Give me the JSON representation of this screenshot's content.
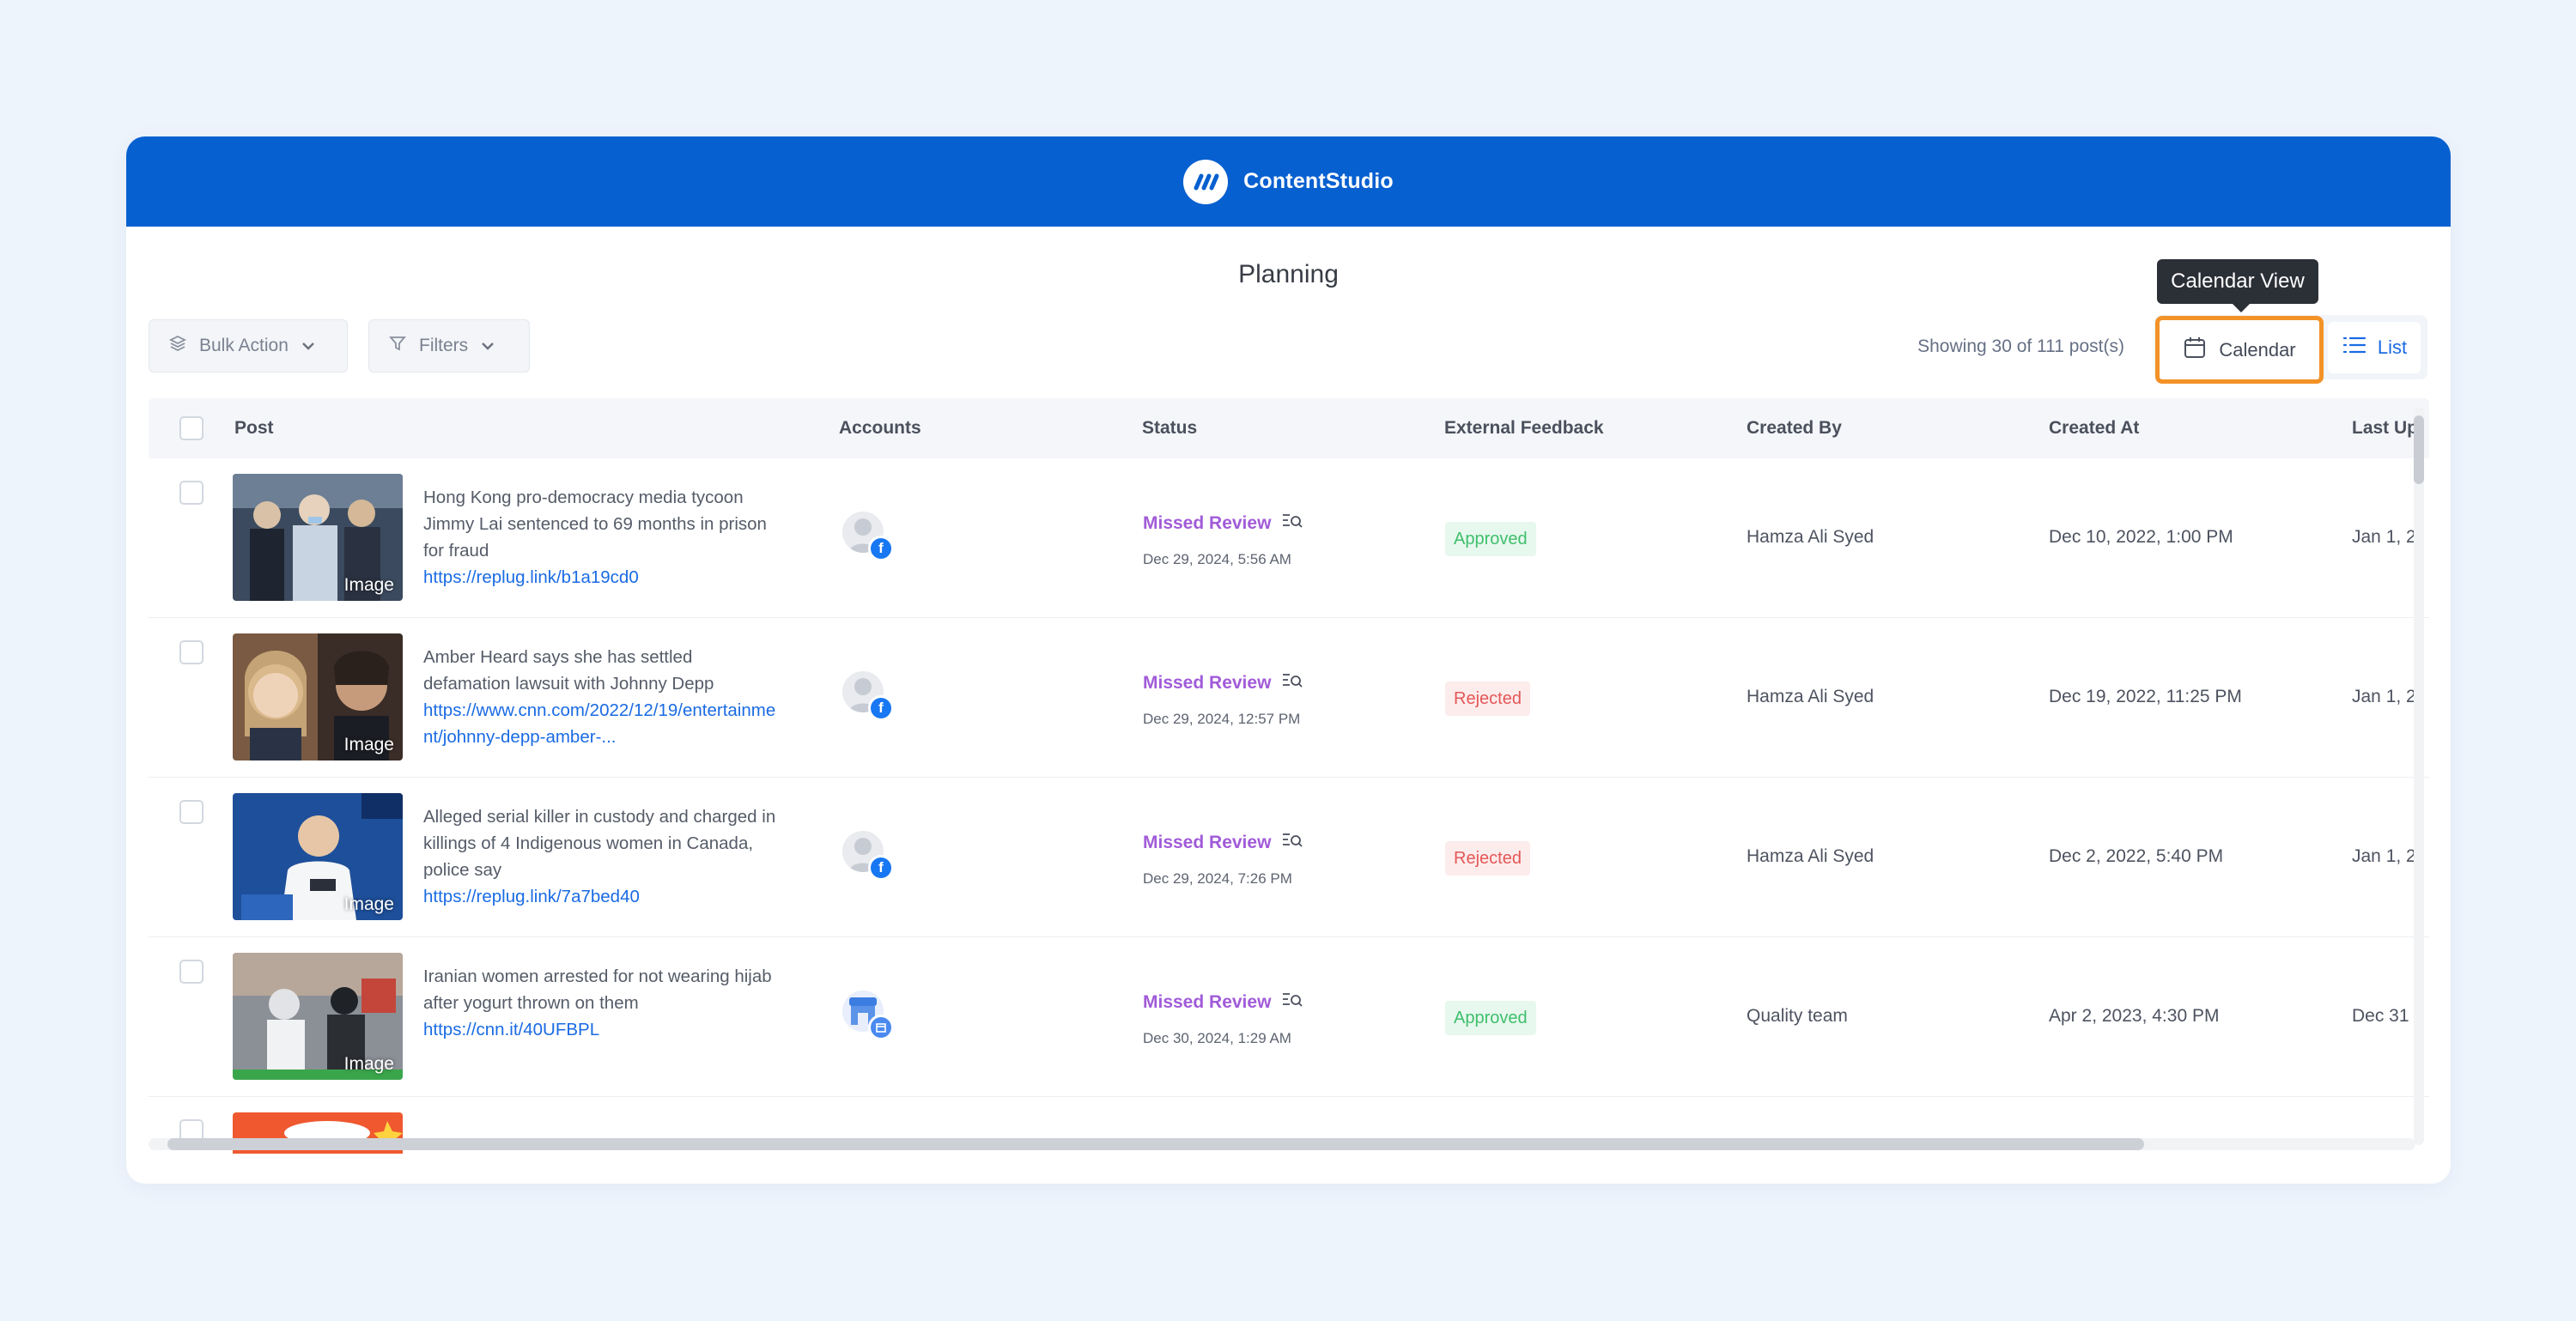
{
  "app": {
    "brand": "ContentStudio"
  },
  "page": {
    "title": "Planning"
  },
  "toolbar": {
    "bulk_action_label": "Bulk Action",
    "filters_label": "Filters",
    "showing_text": "Showing 30 of 111 post(s)",
    "calendar_label": "Calendar",
    "list_label": "List",
    "tooltip": "Calendar View"
  },
  "table": {
    "columns": {
      "post": "Post",
      "accounts": "Accounts",
      "status": "Status",
      "feedback": "External Feedback",
      "created_by": "Created By",
      "created_at": "Created At",
      "last_updated": "Last Up"
    },
    "rows": [
      {
        "title": "Hong Kong pro-democracy media tycoon Jimmy Lai sentenced to 69 months in prison for fraud",
        "link": "https://replug.link/b1a19cd0",
        "thumb_label": "Image",
        "status": "Missed Review",
        "status_date": "Dec 29, 2024, 5:56 AM",
        "feedback": "Approved",
        "created_by": "Hamza Ali Syed",
        "created_at": "Dec 10, 2022, 1:00 PM",
        "last_updated": "Jan 1, 2"
      },
      {
        "title": "Amber Heard says she has settled defamation lawsuit with Johnny Depp",
        "link": "https://www.cnn.com/2022/12/19/entertainment/johnny-depp-amber-...",
        "thumb_label": "Image",
        "status": "Missed Review",
        "status_date": "Dec 29, 2024, 12:57 PM",
        "feedback": "Rejected",
        "created_by": "Hamza Ali Syed",
        "created_at": "Dec 19, 2022, 11:25 PM",
        "last_updated": "Jan 1, 2"
      },
      {
        "title": "Alleged serial killer in custody and charged in killings of 4 Indigenous women in Canada, police say",
        "link": "https://replug.link/7a7bed40",
        "thumb_label": "Image",
        "status": "Missed Review",
        "status_date": "Dec 29, 2024, 7:26 PM",
        "feedback": "Rejected",
        "created_by": "Hamza Ali Syed",
        "created_at": "Dec 2, 2022, 5:40 PM",
        "last_updated": "Jan 1, 2"
      },
      {
        "title": "Iranian women arrested for not wearing hijab after yogurt thrown on them",
        "link": "https://cnn.it/40UFBPL",
        "thumb_label": "Image",
        "status": "Missed Review",
        "status_date": "Dec 30, 2024, 1:29 AM",
        "feedback": "Approved",
        "created_by": "Quality team",
        "created_at": "Apr 2, 2023, 4:30 PM",
        "last_updated": "Dec 31"
      }
    ]
  },
  "colors": {
    "brand": "#0760d0",
    "highlight": "#f39227",
    "missed_review": "#a15bd8",
    "approved": "#3fbf6c",
    "rejected": "#e45757",
    "link": "#1a6be3"
  }
}
